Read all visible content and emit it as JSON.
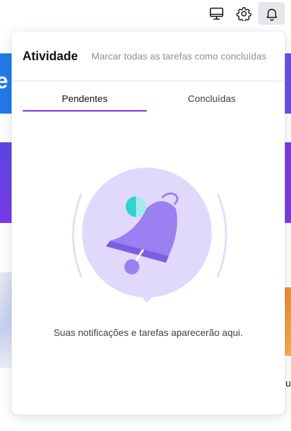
{
  "topbar": {
    "icons": [
      {
        "name": "desktop-icon",
        "label": "Desktop"
      },
      {
        "name": "gear-icon",
        "label": "Configurações"
      },
      {
        "name": "bell-icon",
        "label": "Notificações"
      }
    ]
  },
  "background": {
    "partial_text_top": "e",
    "partial_text_bottom_right": "u",
    "colors": {
      "blue": "#1a73e8",
      "purple": "#6b35e6",
      "orange": "#f0882a"
    }
  },
  "panel": {
    "title": "Atividade",
    "mark_all_label": "Marcar todas as tarefas como concluídas",
    "tabs": [
      {
        "label": "Pendentes",
        "active": true
      },
      {
        "label": "Concluídas",
        "active": false
      }
    ],
    "empty_message": "Suas notificações e tarefas aparecerão aqui."
  },
  "colors": {
    "accent": "#7d2ae8",
    "illustration_circle": "#e1d9fb",
    "bell": "#9c7ff0",
    "teal_dot": "#2fd3d0"
  }
}
